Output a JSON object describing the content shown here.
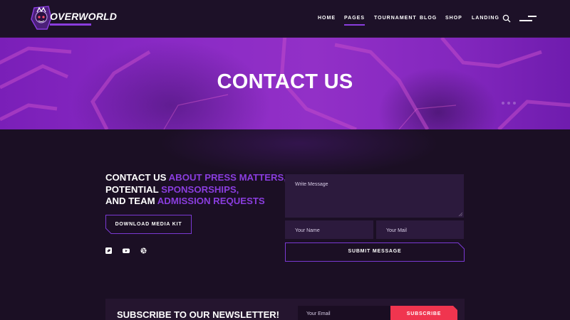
{
  "brand": {
    "name": "OVERWORLD",
    "accent": "#8a3dde",
    "cta_color": "#f0354f"
  },
  "nav": {
    "items": [
      {
        "label": "HOME"
      },
      {
        "label": "PAGES",
        "active": true
      },
      {
        "label": "TOURNAMENT"
      },
      {
        "label": "BLOG"
      },
      {
        "label": "SHOP"
      },
      {
        "label": "LANDING"
      }
    ],
    "search_icon": "search-icon",
    "menu_icon": "hamburger-menu-icon"
  },
  "hero": {
    "title": "CONTACT US"
  },
  "contact": {
    "headline": {
      "line1_white": "CONTACT US ",
      "line1_accent": "ABOUT PRESS MATTERS,",
      "line2_white": "POTENTIAL ",
      "line2_accent": "SPONSORSHIPS,",
      "line3_white": "AND TEAM ",
      "line3_accent": "ADMISSION REQUESTS"
    },
    "media_kit_label": "DOWNLOAD MEDIA KIT",
    "social_icons": [
      "twitter-icon",
      "youtube-icon",
      "dribbble-icon"
    ]
  },
  "form": {
    "message_placeholder": "Write Message",
    "name_placeholder": "Your Name",
    "mail_placeholder": "Your Mail",
    "submit_label": "SUBMIT MESSAGE"
  },
  "newsletter": {
    "title": "SUBSCRIBE TO OUR NEWSLETTER!",
    "email_placeholder": "Your Email",
    "button_label": "SUBSCRIBE"
  }
}
